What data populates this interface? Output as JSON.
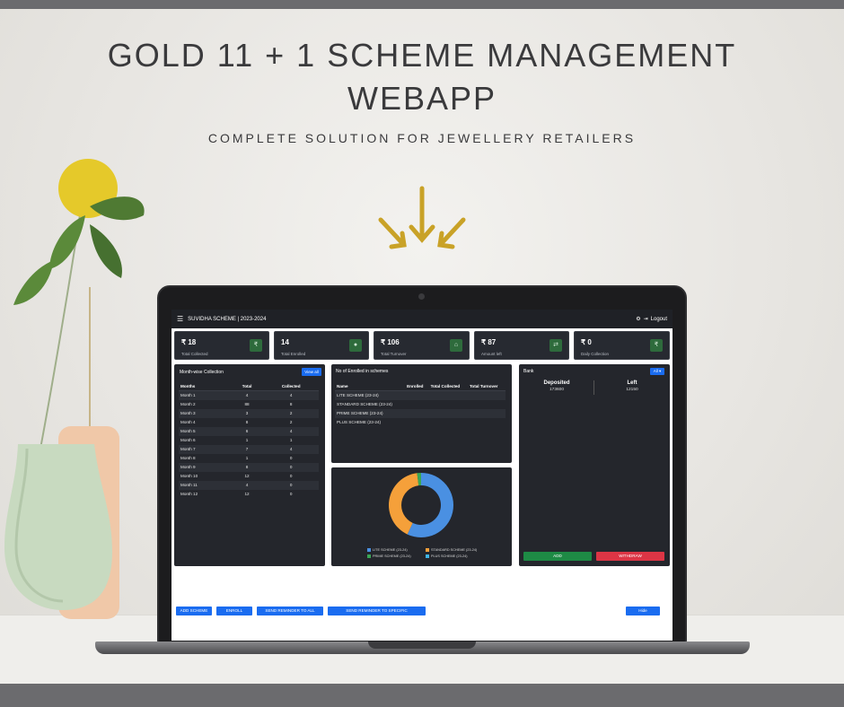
{
  "hero": {
    "title_line1": "GOLD 11 + 1 SCHEME MANAGEMENT",
    "title_line2": "WEBAPP",
    "subtitle": "COMPLETE SOLUTION FOR JEWELLERY RETAILERS"
  },
  "app": {
    "title": "SUVIDHA SCHEME | 2023-2024",
    "logout_label": "Logout"
  },
  "stats": [
    {
      "value": "₹ 18",
      "label": "Total Collected",
      "icon": "rupee-icon"
    },
    {
      "value": "14",
      "label": "Total Enrolled",
      "icon": "user-icon"
    },
    {
      "value": "₹ 106",
      "label": "Total Turnover",
      "icon": "bank-icon"
    },
    {
      "value": "₹ 87",
      "label": "Amount left",
      "icon": "transfer-icon"
    },
    {
      "value": "₹ 0",
      "label": "Daily Collection",
      "icon": "rupee-icon"
    }
  ],
  "monthwise": {
    "title": "Month-wise Collection",
    "view_all": "View all",
    "headers": [
      "Months",
      "Total",
      "Collected"
    ],
    "rows": [
      [
        "Month 1",
        "4",
        "4"
      ],
      [
        "Month 2",
        "88",
        "8"
      ],
      [
        "Month 3",
        "3",
        "2"
      ],
      [
        "Month 4",
        "8",
        "2"
      ],
      [
        "Month 5",
        "6",
        "4"
      ],
      [
        "Month 6",
        "1",
        "1"
      ],
      [
        "Month 7",
        "7",
        "4"
      ],
      [
        "Month 8",
        "1",
        "0"
      ],
      [
        "Month 9",
        "8",
        "0"
      ],
      [
        "Month 10",
        "12",
        "0"
      ],
      [
        "Month 11",
        "4",
        "0"
      ],
      [
        "Month 12",
        "12",
        "0"
      ]
    ]
  },
  "schemes": {
    "title": "No of Enrolled in schemes",
    "headers": [
      "Name",
      "Enrolled",
      "Total Collected",
      "Total Turnover"
    ],
    "rows": [
      [
        "LITE SCHEME (23-24)",
        "",
        "",
        ""
      ],
      [
        "STANDARD SCHEME (23-24)",
        "",
        "",
        ""
      ],
      [
        "PRIME SCHEME (23-24)",
        "",
        "",
        ""
      ],
      [
        "PLUS SCHEME (23-24)",
        "",
        "",
        ""
      ]
    ]
  },
  "chart_data": {
    "type": "pie",
    "categories": [
      "LITE SCHEME (23-24)",
      "STANDARD SCHEME (23-24)",
      "PRIME SCHEME (23-24)",
      "PLUS SCHEME (23-24)"
    ],
    "values": [
      57,
      41,
      2,
      0
    ],
    "colors": [
      "#4a90e2",
      "#f5a03a",
      "#3aa655",
      "#3fb6e8"
    ],
    "donut": true,
    "legend_position": "bottom"
  },
  "bank": {
    "title": "Bank",
    "filter": "All",
    "deposited_label": "Deposited",
    "deposited_value": "173600",
    "left_label": "Left",
    "left_value": "12150",
    "add_label": "ADD",
    "withdraw_label": "WITHDRAW"
  },
  "actions": {
    "add_scheme": "ADD SCHEME",
    "enroll": "ENROLL",
    "reminder_all": "SEND REMINDER TO ALL",
    "reminder_specific": "SEND REMINDER TO SPECIFIC",
    "hide": "Hide"
  }
}
